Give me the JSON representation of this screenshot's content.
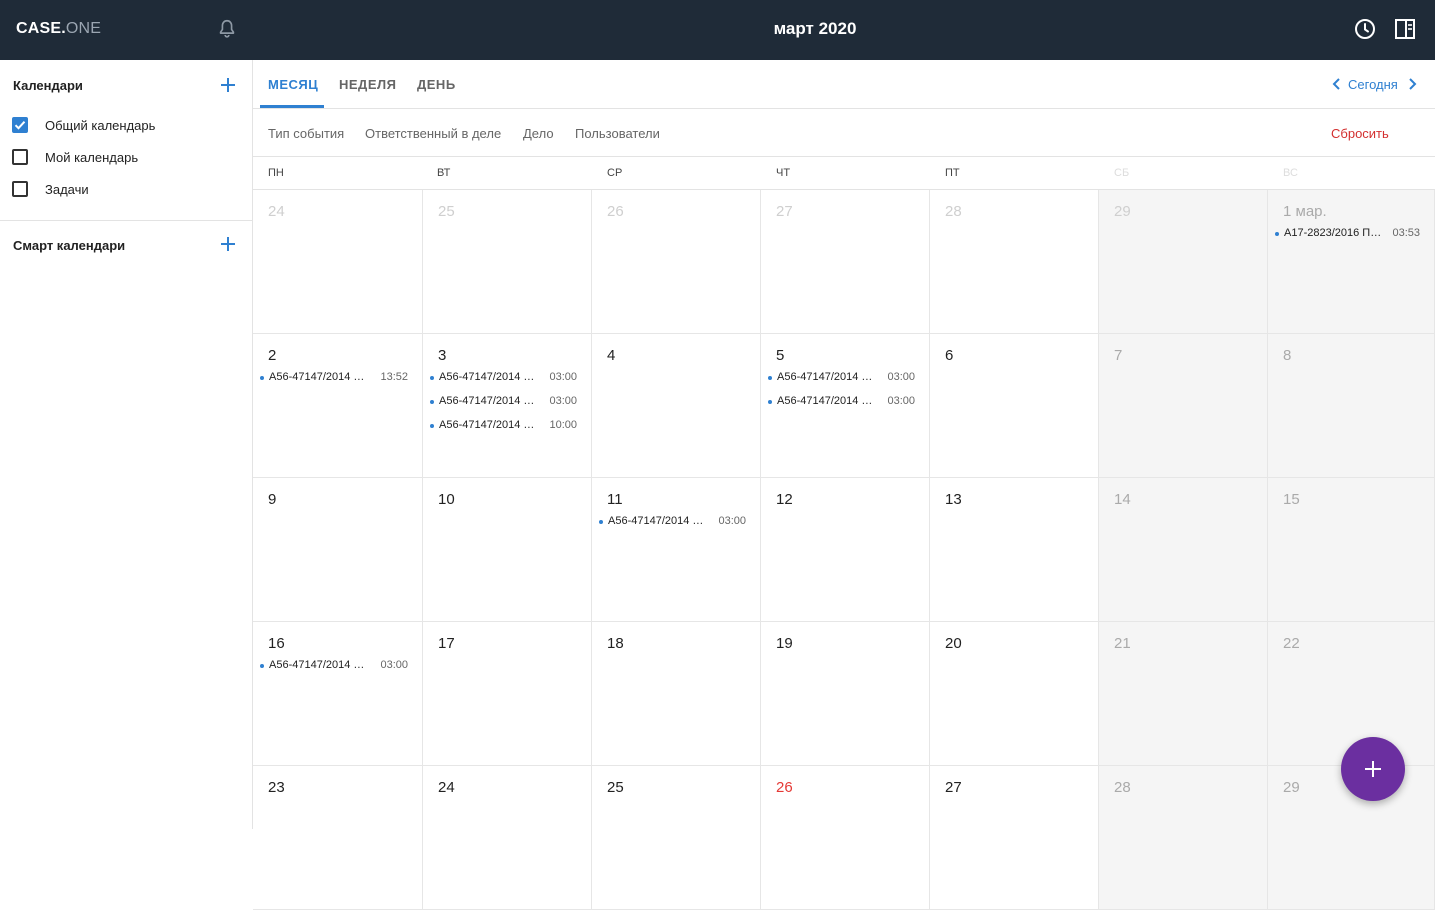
{
  "header": {
    "logo_main": "CASE.",
    "logo_sub": "ONE",
    "title": "март 2020",
    "icons": [
      "bell-icon",
      "clock-icon",
      "panel-icon"
    ]
  },
  "sidebar": {
    "calendars_title": "Календари",
    "calendars": [
      {
        "label": "Общий календарь",
        "checked": true
      },
      {
        "label": "Мой календарь",
        "checked": false
      },
      {
        "label": "Задачи",
        "checked": false
      }
    ],
    "smart_title": "Смарт календари"
  },
  "tabs": [
    {
      "label": "МЕСЯЦ",
      "active": true
    },
    {
      "label": "НЕДЕЛЯ",
      "active": false
    },
    {
      "label": "ДЕНЬ",
      "active": false
    }
  ],
  "nav": {
    "today": "Сегодня"
  },
  "filters": {
    "items": [
      "Тип события",
      "Ответственный в деле",
      "Дело",
      "Пользователи"
    ],
    "reset": "Сбросить"
  },
  "weekdays": [
    "ПН",
    "ВТ",
    "СР",
    "ЧТ",
    "ПТ",
    "СБ",
    "ВС"
  ],
  "weeks": [
    [
      {
        "day": "24",
        "muted": true,
        "events": []
      },
      {
        "day": "25",
        "muted": true,
        "events": []
      },
      {
        "day": "26",
        "muted": true,
        "events": []
      },
      {
        "day": "27",
        "muted": true,
        "events": []
      },
      {
        "day": "28",
        "muted": true,
        "events": []
      },
      {
        "day": "29",
        "muted": true,
        "events": []
      },
      {
        "day": "1 мар.",
        "muted": false,
        "events": [
          {
            "title": "А17-2823/2016 Пр…",
            "time": "03:53"
          }
        ]
      }
    ],
    [
      {
        "day": "2",
        "events": [
          {
            "title": "А56-47147/2014 З…",
            "time": "13:52"
          }
        ]
      },
      {
        "day": "3",
        "events": [
          {
            "title": "А56-47147/2014 О…",
            "time": "03:00"
          },
          {
            "title": "А56-47147/2014 Х…",
            "time": "03:00"
          },
          {
            "title": "А56-47147/2014 З…",
            "time": "10:00"
          }
        ]
      },
      {
        "day": "4",
        "events": []
      },
      {
        "day": "5",
        "events": [
          {
            "title": "А56-47147/2014 О…",
            "time": "03:00"
          },
          {
            "title": "А56-47147/2014 Х…",
            "time": "03:00"
          }
        ]
      },
      {
        "day": "6",
        "events": []
      },
      {
        "day": "7",
        "events": []
      },
      {
        "day": "8",
        "events": []
      }
    ],
    [
      {
        "day": "9",
        "events": []
      },
      {
        "day": "10",
        "events": []
      },
      {
        "day": "11",
        "events": [
          {
            "title": "А56-47147/2014 О…",
            "time": "03:00"
          }
        ]
      },
      {
        "day": "12",
        "events": []
      },
      {
        "day": "13",
        "events": []
      },
      {
        "day": "14",
        "events": []
      },
      {
        "day": "15",
        "events": []
      }
    ],
    [
      {
        "day": "16",
        "events": [
          {
            "title": "А56-47147/2014 Х…",
            "time": "03:00"
          }
        ]
      },
      {
        "day": "17",
        "events": []
      },
      {
        "day": "18",
        "events": []
      },
      {
        "day": "19",
        "events": []
      },
      {
        "day": "20",
        "events": []
      },
      {
        "day": "21",
        "events": []
      },
      {
        "day": "22",
        "events": []
      }
    ],
    [
      {
        "day": "23",
        "events": []
      },
      {
        "day": "24",
        "events": []
      },
      {
        "day": "25",
        "events": []
      },
      {
        "day": "26",
        "today": true,
        "events": []
      },
      {
        "day": "27",
        "events": []
      },
      {
        "day": "28",
        "events": []
      },
      {
        "day": "29",
        "events": []
      }
    ]
  ],
  "colors": {
    "accent": "#2f80d1",
    "topbar": "#1f2b38",
    "fab": "#6b2fa0",
    "today": "#e53935",
    "reset": "#d32f2f"
  }
}
